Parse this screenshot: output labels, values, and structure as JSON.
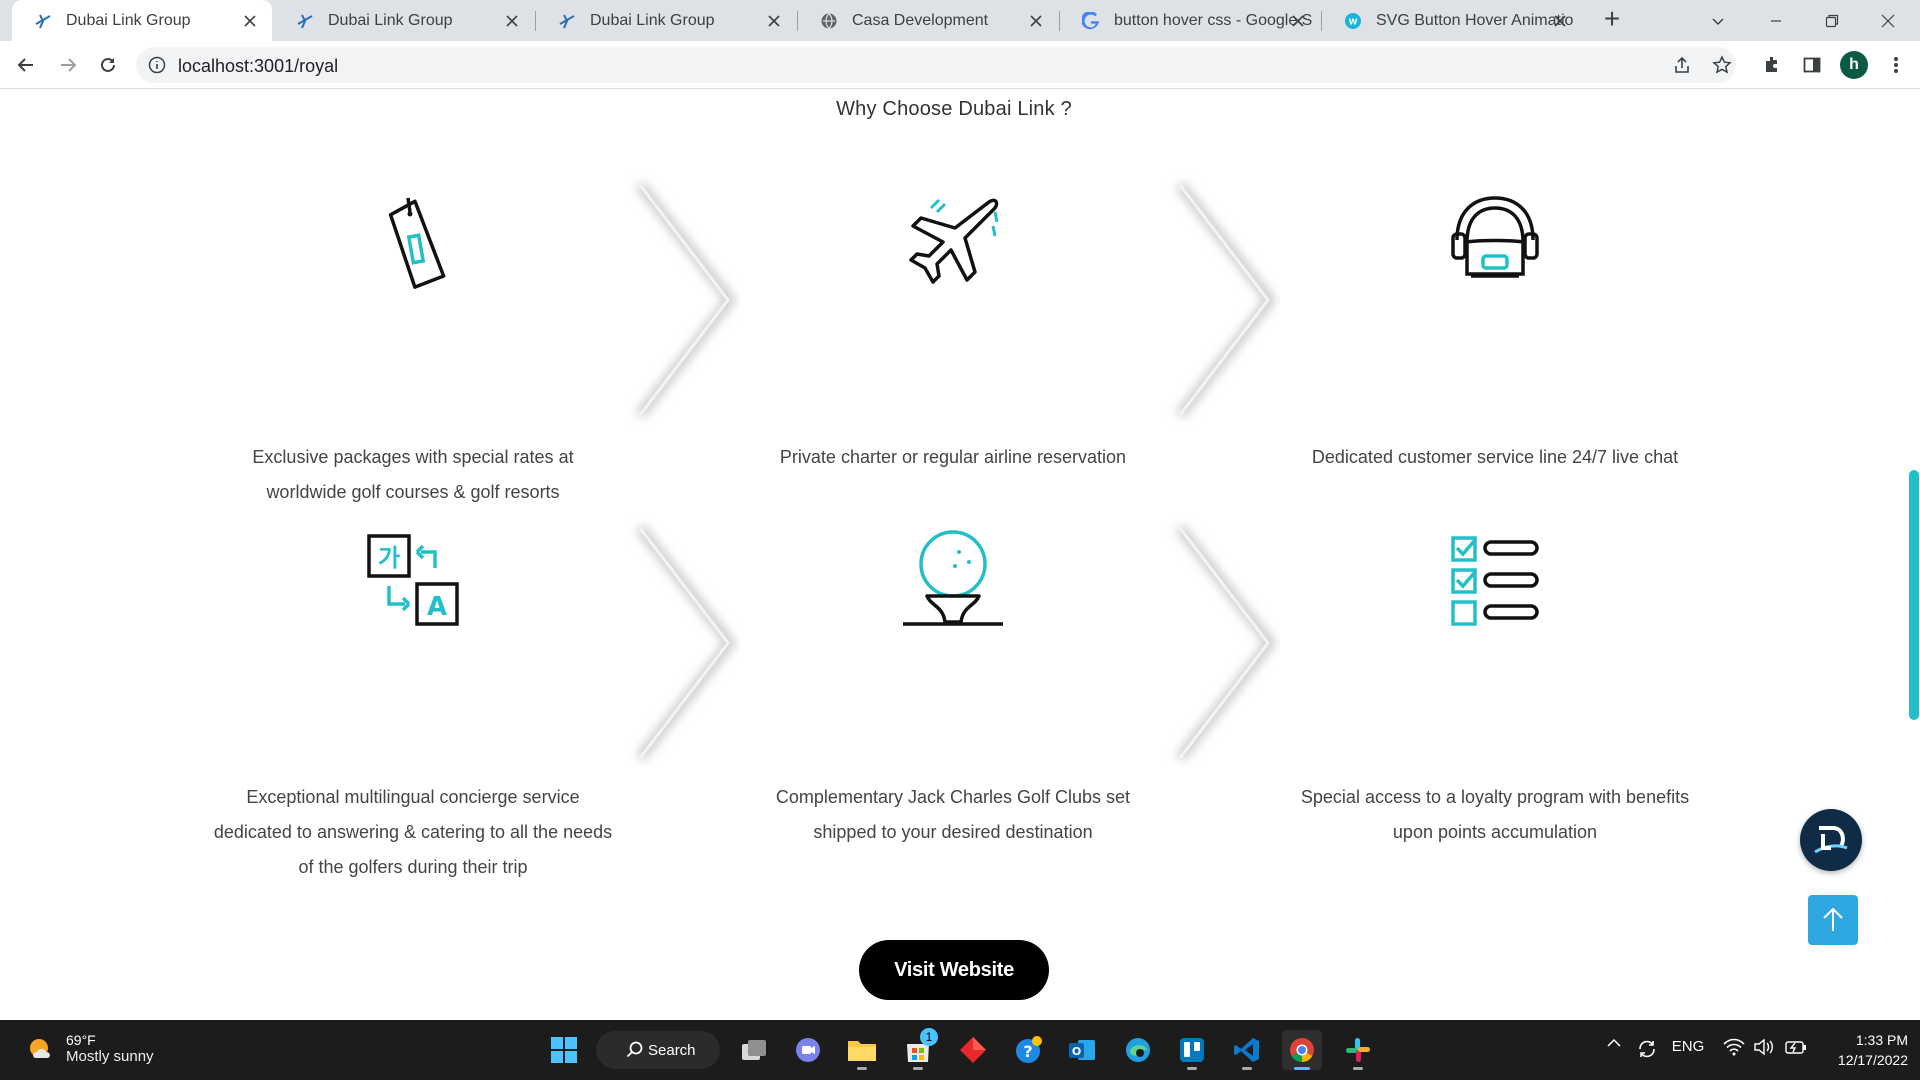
{
  "browser": {
    "tabs": [
      {
        "title": "Dubai Link Group",
        "favicon": "dubai-link-favicon",
        "active": true
      },
      {
        "title": "Dubai Link Group",
        "favicon": "dubai-link-favicon",
        "active": false
      },
      {
        "title": "Dubai Link Group",
        "favicon": "dubai-link-favicon",
        "active": false
      },
      {
        "title": "Casa Development",
        "favicon": "globe-favicon",
        "active": false
      },
      {
        "title": "button hover css - Google S",
        "favicon": "google-favicon",
        "active": false
      },
      {
        "title": "SVG Button Hover Animatio",
        "favicon": "web-favicon",
        "active": false
      }
    ],
    "url": "localhost:3001/royal",
    "profile_initial": "h"
  },
  "page": {
    "section_title": "Why Choose Dubai Link ?",
    "features": [
      {
        "icon": "price-tag-icon",
        "text": "Exclusive packages with special rates at worldwide golf courses & golf resorts"
      },
      {
        "icon": "airplane-icon",
        "text": "Private charter or regular airline reservation"
      },
      {
        "icon": "headset-agent-icon",
        "text": "Dedicated customer service line 24/7 live chat"
      },
      {
        "icon": "translate-icon",
        "text": "Exceptional multilingual concierge service dedicated to answering & catering to all the needs of the golfers during their trip"
      },
      {
        "icon": "golf-ball-tee-icon",
        "text": "Complementary Jack Charles Golf Clubs set shipped to your desired destination"
      },
      {
        "icon": "checklist-icon",
        "text": "Special access to a loyalty program with benefits upon points accumulation"
      }
    ],
    "visit_button": "Visit Website",
    "accent_color": "#23bfc9"
  },
  "taskbar": {
    "weather_temp": "69°F",
    "weather_condition": "Mostly sunny",
    "search_label": "Search",
    "language": "ENG",
    "time": "1:33 PM",
    "date": "12/17/2022",
    "store_badge": "1"
  }
}
